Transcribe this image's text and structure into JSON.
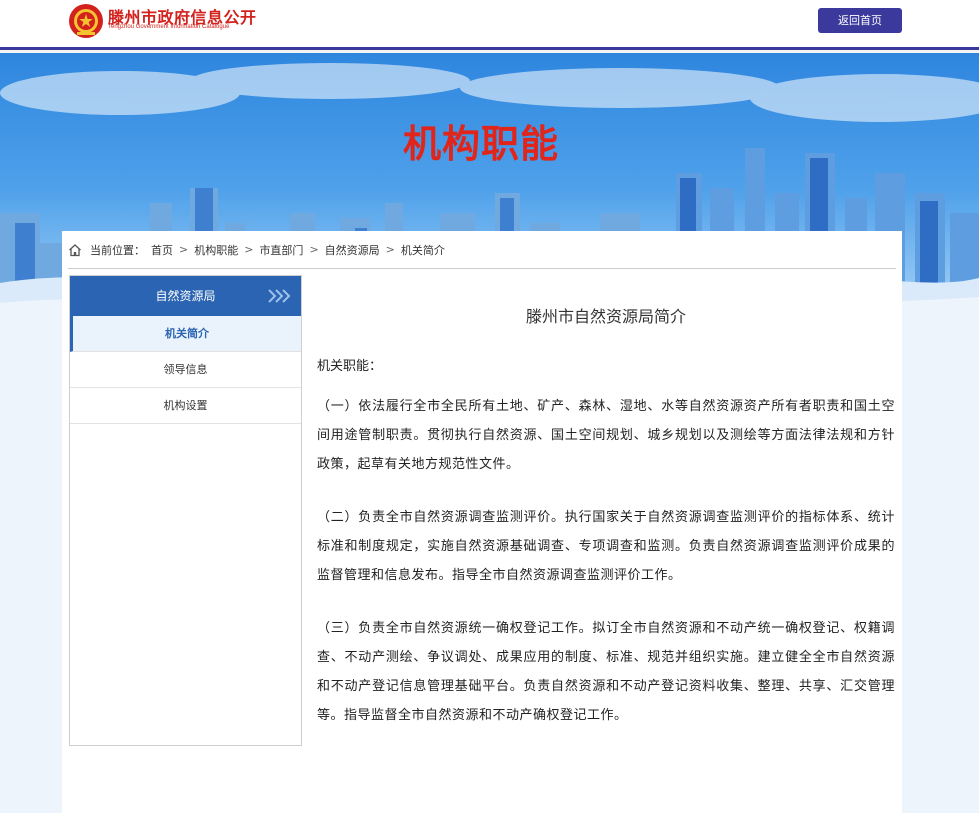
{
  "header": {
    "site_title": "滕州市政府信息公开",
    "site_subtitle": "Tengzhou Government Information Catalogue",
    "home_button": "返回首页",
    "accent_color": "#3b3a9c",
    "logo_icon": "national-emblem-icon"
  },
  "banner": {
    "title": "机构职能",
    "title_color": "#e1251b"
  },
  "breadcrumb": {
    "prefix": "当前位置：",
    "items": [
      "首页",
      "机构职能",
      "市直部门",
      "自然资源局",
      "机关简介"
    ],
    "separator": ">"
  },
  "sidebar": {
    "title": "自然资源局",
    "items": [
      {
        "label": "机关简介",
        "active": true
      },
      {
        "label": "领导信息",
        "active": false
      },
      {
        "label": "机构设置",
        "active": false
      }
    ]
  },
  "article": {
    "title": "滕州市自然资源局简介",
    "section_label": "机关职能：",
    "paragraphs": [
      "（一）依法履行全市全民所有土地、矿产、森林、湿地、水等自然资源资产所有者职责和国土空间用途管制职责。贯彻执行自然资源、国土空间规划、城乡规划以及测绘等方面法律法规和方针政策，起草有关地方规范性文件。",
      "（二）负责全市自然资源调查监测评价。执行国家关于自然资源调查监测评价的指标体系、统计标准和制度规定，实施自然资源基础调查、专项调查和监测。负责自然资源调查监测评价成果的监督管理和信息发布。指导全市自然资源调查监测评价工作。",
      "（三）负责全市自然资源统一确权登记工作。拟订全市自然资源和不动产统一确权登记、权籍调查、不动产测绘、争议调处、成果应用的制度、标准、规范并组织实施。建立健全全市自然资源和不动产登记信息管理基础平台。负责自然资源和不动产登记资料收集、整理、共享、汇交管理等。指导监督全市自然资源和不动产确权登记工作。"
    ]
  }
}
